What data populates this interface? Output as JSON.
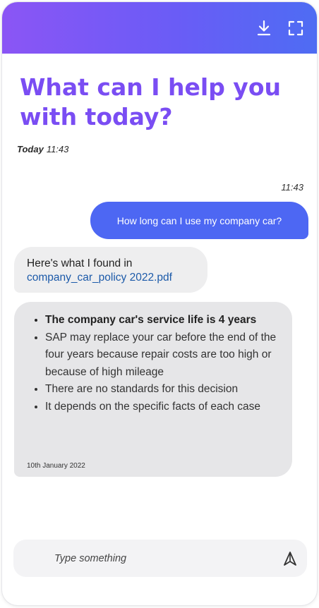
{
  "header": {
    "icons": [
      "download-icon",
      "fullscreen-icon"
    ],
    "gradient": [
      "#8b55f5",
      "#4e6cf3"
    ]
  },
  "greeting": "What can I help you with today?",
  "session": {
    "day": "Today",
    "time": "11:43"
  },
  "messages": [
    {
      "from": "user",
      "time": "11:43",
      "text": "How long can I use my company car?"
    },
    {
      "from": "bot",
      "text": "Here's what I found in",
      "link": "company_car_policy 2022.pdf"
    },
    {
      "from": "bot",
      "bullets": [
        "The company car's service life is 4 years",
        "SAP may replace your car before the end of the four years because repair costs are too high or because of high mileage",
        "There are no standards for this decision",
        "It depends on the specific facts of each case"
      ],
      "date": "10th January 2022"
    }
  ],
  "composer": {
    "placeholder": "Type something",
    "send_icon": "send-icon"
  },
  "colors": {
    "accent": "#7a4df3",
    "user_bubble": "#4d67f3",
    "bot_bubble": "#e6e6e8"
  }
}
